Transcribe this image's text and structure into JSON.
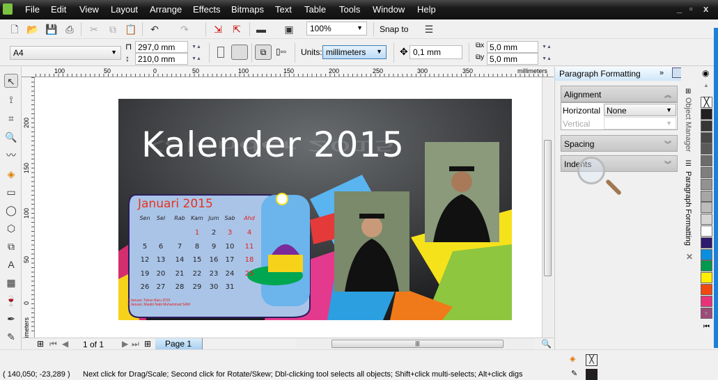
{
  "menu": [
    "File",
    "Edit",
    "View",
    "Layout",
    "Arrange",
    "Effects",
    "Bitmaps",
    "Text",
    "Table",
    "Tools",
    "Window",
    "Help"
  ],
  "toolbar": {
    "zoom": "100%",
    "snap_to": "Snap to"
  },
  "propbar": {
    "page_size": "A4",
    "width": "297,0 mm",
    "height": "210,0 mm",
    "units_label": "Units:",
    "units": "millimeters",
    "nudge": "0,1 mm",
    "dup_x": "5,0 mm",
    "dup_y": "5,0 mm"
  },
  "ruler": {
    "top_labels": [
      "100",
      "50",
      "0",
      "50",
      "100",
      "150",
      "200",
      "250",
      "300",
      "350"
    ],
    "left_labels": [
      "200",
      "150",
      "100",
      "50",
      "0"
    ],
    "unit": "millimeters"
  },
  "artwork": {
    "title": "Kalender 2015",
    "month": "Januari 2015",
    "days": [
      "Sen",
      "Sel",
      "Rab",
      "Kam",
      "Jum",
      "Sab",
      "Ahd"
    ],
    "weeks": [
      [
        "",
        "",
        "",
        "1",
        "2",
        "3",
        "4"
      ],
      [
        "5",
        "6",
        "7",
        "8",
        "9",
        "10",
        "11"
      ],
      [
        "12",
        "13",
        "14",
        "15",
        "16",
        "17",
        "18"
      ],
      [
        "19",
        "20",
        "21",
        "22",
        "23",
        "24",
        "25"
      ],
      [
        "26",
        "27",
        "28",
        "29",
        "30",
        "31",
        ""
      ]
    ],
    "notes": [
      "1 Januari, Tahun Baru 2015",
      "3 Januari, Maulid Nabi Muhammad SAW"
    ]
  },
  "page_nav": {
    "counter": "1 of 1",
    "tab": "Page 1"
  },
  "docker": {
    "title": "Paragraph Formatting",
    "alignment": "Alignment",
    "horizontal_label": "Horizontal",
    "horizontal_value": "None",
    "vertical_label": "Vertical",
    "spacing": "Spacing",
    "indents": "Indents",
    "tab_object_manager": "Object Manager",
    "tab_paragraph": "Paragraph Formatting"
  },
  "palette": [
    "#231f20",
    "#383635",
    "#4a4847",
    "#5b5a59",
    "#6d6c6b",
    "#807f7e",
    "#939291",
    "#a7a6a5",
    "#bdbcbb",
    "#d6d5d4",
    "#ffffff",
    "#2e1a6e",
    "#0a8ee0",
    "#009a4e",
    "#ffee00",
    "#f04a10",
    "#e8327a",
    "#a04a7a"
  ],
  "status": {
    "coords": "( 140,050; -23,289 )",
    "message": "Next click for Drag/Scale; Second click for Rotate/Skew; Dbl-clicking tool selects all objects; Shift+click multi-selects; Alt+click digs"
  }
}
